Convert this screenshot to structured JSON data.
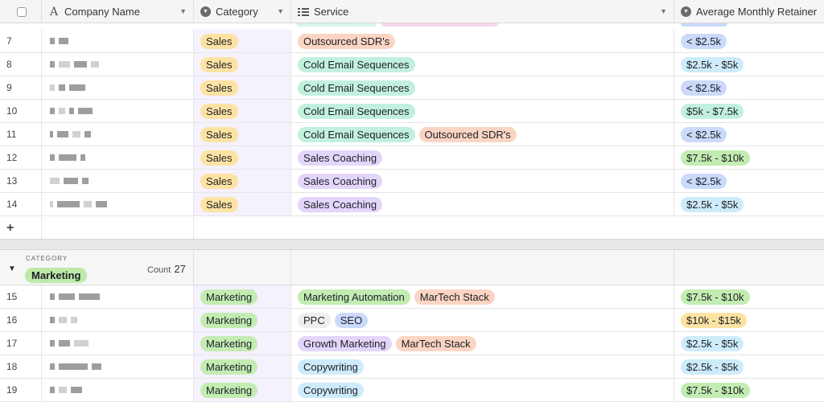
{
  "colors": {
    "sales": "#fde3a3",
    "marketing": "#c3ecb2",
    "outsourced_sdr": "#fbd5c3",
    "cold_email": "#c2f0df",
    "sales_coaching": "#e4d5fb",
    "marketing_automation": "#c3ecb2",
    "martech_stack": "#fbd5c3",
    "ppc": "#eeeeee",
    "seo": "#cbd9fb",
    "growth_marketing": "#e4d5fb",
    "copywriting": "#cdebfb",
    "ret_lt_2_5": "#cbd9fb",
    "ret_2_5_5": "#cdebfb",
    "ret_5_7_5": "#c2f0df",
    "ret_7_5_10": "#c3ecb2",
    "ret_10_15": "#fde3a3"
  },
  "header": {
    "company_name": "Company Name",
    "category": "Category",
    "service": "Service",
    "retainer": "Average Monthly Retainer"
  },
  "icons": {
    "checkbox": "select-all-checkbox",
    "text_field": "text-field-icon",
    "single_select": "single-select-icon",
    "multi_select": "multi-select-icon",
    "dropdown": "chevron-down-icon",
    "add": "plus-icon",
    "collapse": "collapse-triangle-icon"
  },
  "sales_rows": [
    {
      "num": "7",
      "category": "Sales",
      "services": [
        {
          "label": "Outsourced SDR's",
          "color": "#fbd5c3"
        }
      ],
      "retainer": {
        "label": "< $2.5k",
        "color": "#cbd9fb"
      }
    },
    {
      "num": "8",
      "category": "Sales",
      "services": [
        {
          "label": "Cold Email Sequences",
          "color": "#c2f0df"
        }
      ],
      "retainer": {
        "label": "$2.5k - $5k",
        "color": "#cdebfb"
      }
    },
    {
      "num": "9",
      "category": "Sales",
      "services": [
        {
          "label": "Cold Email Sequences",
          "color": "#c2f0df"
        }
      ],
      "retainer": {
        "label": "< $2.5k",
        "color": "#cbd9fb"
      }
    },
    {
      "num": "10",
      "category": "Sales",
      "services": [
        {
          "label": "Cold Email Sequences",
          "color": "#c2f0df"
        }
      ],
      "retainer": {
        "label": "$5k - $7.5k",
        "color": "#c2f0df"
      }
    },
    {
      "num": "11",
      "category": "Sales",
      "services": [
        {
          "label": "Cold Email Sequences",
          "color": "#c2f0df"
        },
        {
          "label": "Outsourced SDR's",
          "color": "#fbd5c3"
        }
      ],
      "retainer": {
        "label": "< $2.5k",
        "color": "#cbd9fb"
      }
    },
    {
      "num": "12",
      "category": "Sales",
      "services": [
        {
          "label": "Sales Coaching",
          "color": "#e4d5fb"
        }
      ],
      "retainer": {
        "label": "$7.5k - $10k",
        "color": "#c3ecb2"
      }
    },
    {
      "num": "13",
      "category": "Sales",
      "services": [
        {
          "label": "Sales Coaching",
          "color": "#e4d5fb"
        }
      ],
      "retainer": {
        "label": "< $2.5k",
        "color": "#cbd9fb"
      }
    },
    {
      "num": "14",
      "category": "Sales",
      "services": [
        {
          "label": "Sales Coaching",
          "color": "#e4d5fb"
        }
      ],
      "retainer": {
        "label": "$2.5k - $5k",
        "color": "#cdebfb"
      }
    }
  ],
  "group": {
    "heading": "CATEGORY",
    "name": "Marketing",
    "count_label": "Count",
    "count": "27"
  },
  "marketing_rows": [
    {
      "num": "15",
      "category": "Marketing",
      "services": [
        {
          "label": "Marketing Automation",
          "color": "#c3ecb2"
        },
        {
          "label": "MarTech Stack",
          "color": "#fbd5c3"
        }
      ],
      "retainer": {
        "label": "$7.5k - $10k",
        "color": "#c3ecb2"
      }
    },
    {
      "num": "16",
      "category": "Marketing",
      "services": [
        {
          "label": "PPC",
          "color": "#eeeeee"
        },
        {
          "label": "SEO",
          "color": "#cbd9fb"
        }
      ],
      "retainer": {
        "label": "$10k - $15k",
        "color": "#fde3a3"
      }
    },
    {
      "num": "17",
      "category": "Marketing",
      "services": [
        {
          "label": "Growth Marketing",
          "color": "#e4d5fb"
        },
        {
          "label": "MarTech Stack",
          "color": "#fbd5c3"
        }
      ],
      "retainer": {
        "label": "$2.5k - $5k",
        "color": "#cdebfb"
      }
    },
    {
      "num": "18",
      "category": "Marketing",
      "services": [
        {
          "label": "Copywriting",
          "color": "#cdebfb"
        }
      ],
      "retainer": {
        "label": "$2.5k - $5k",
        "color": "#cdebfb"
      }
    },
    {
      "num": "19",
      "category": "Marketing",
      "services": [
        {
          "label": "Copywriting",
          "color": "#cdebfb"
        }
      ],
      "retainer": {
        "label": "$7.5k - $10k",
        "color": "#c3ecb2"
      }
    }
  ]
}
